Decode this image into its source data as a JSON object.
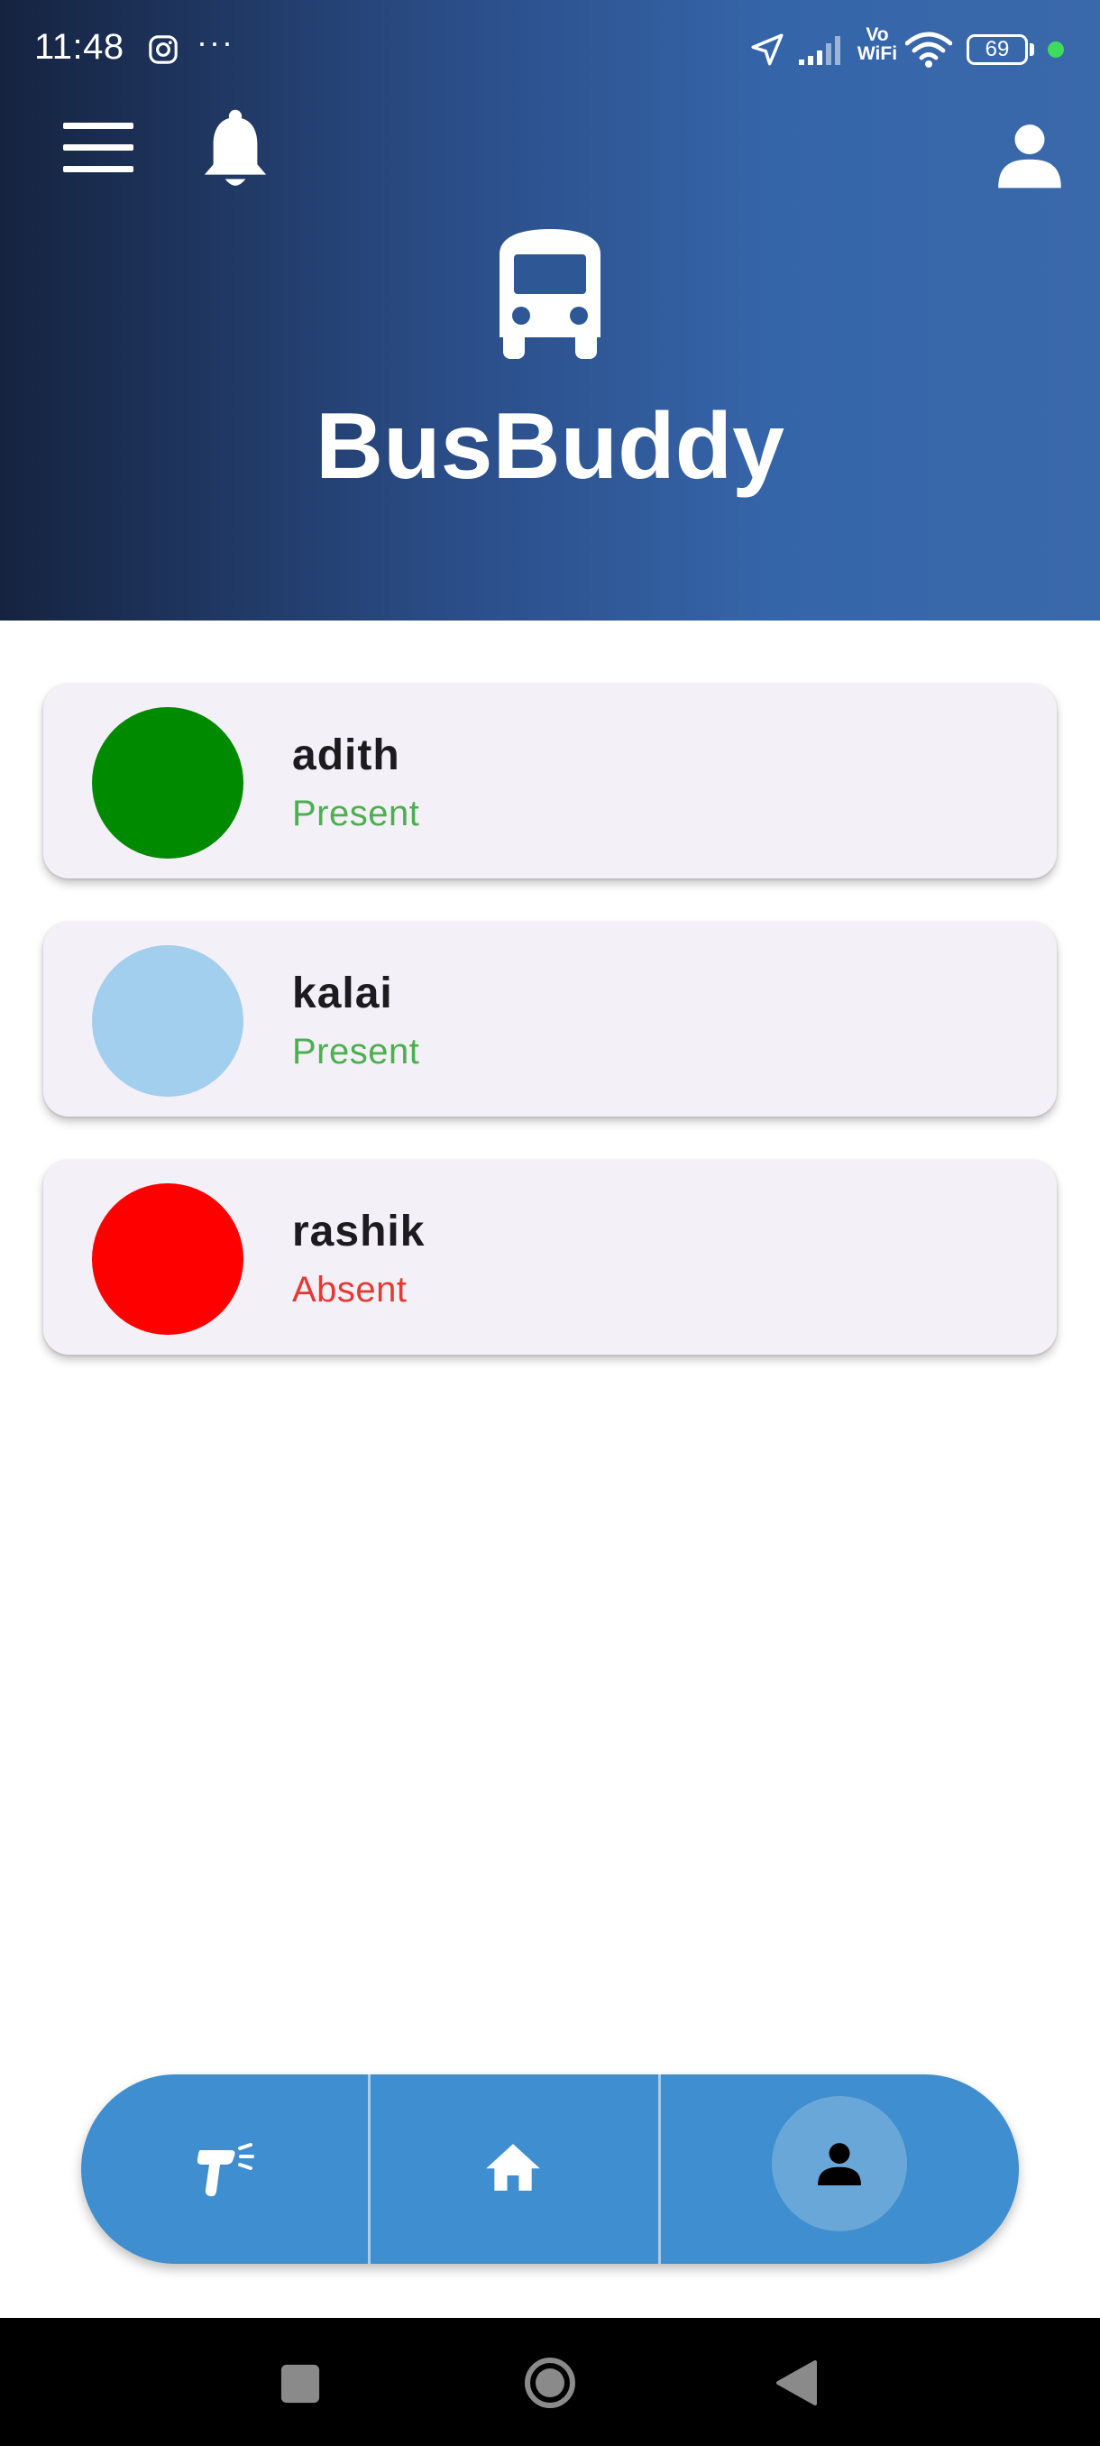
{
  "status_bar": {
    "time": "11:48",
    "more_indicator": "···",
    "network_label_top": "Vo",
    "network_label_bottom": "WiFi",
    "battery_level": "69",
    "icons": [
      "instagram-icon",
      "location-arrow-icon",
      "signal-icon",
      "wifi-icon",
      "battery-icon"
    ]
  },
  "header": {
    "title": "BusBuddy",
    "logo_icon": "bus-icon",
    "menu_icon": "hamburger-menu-icon",
    "notification_icon": "bell-icon",
    "profile_icon": "person-icon",
    "gradient_colors": [
      "#15233f",
      "#3a69ab"
    ]
  },
  "students": [
    {
      "name": "adith",
      "status": "Present",
      "avatar_color": "#008a00",
      "status_color": "#4caf50"
    },
    {
      "name": "kalai",
      "status": "Present",
      "avatar_color": "#a2cfed",
      "status_color": "#4caf50"
    },
    {
      "name": "rashik",
      "status": "Absent",
      "avatar_color": "#ff0000",
      "status_color": "#e53935"
    }
  ],
  "bottom_nav": {
    "items": [
      {
        "icon": "scanner-gun-icon",
        "active": false
      },
      {
        "icon": "home-icon",
        "active": false
      },
      {
        "icon": "person-icon",
        "active": true
      }
    ],
    "background_color": "#3f8ecf"
  },
  "system_nav": {
    "icons": [
      "square-recents-icon",
      "circle-home-icon",
      "triangle-back-icon"
    ]
  }
}
